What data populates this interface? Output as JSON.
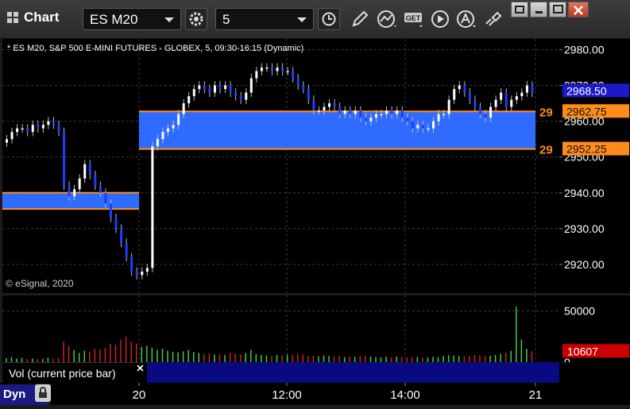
{
  "toolbar": {
    "title": "Chart",
    "symbol": "ES M20",
    "interval": "5",
    "get_label": "GET"
  },
  "chart": {
    "header": "* ES M20, S&P 500 E-MINI FUTURES - GLOBEX, 5, 09:30-16:15 (Dynamic)",
    "watermark": "© eSignal, 2020",
    "y_ticks": [
      "2980.00",
      "2970.00",
      "2960.00",
      "2950.00",
      "2940.00",
      "2930.00",
      "2920.00"
    ],
    "last_price": "2968.50",
    "zone_upper_price": "2962.75",
    "zone_lower_price": "2952.25",
    "zone_upper_short": "29",
    "zone_lower_short": "29"
  },
  "volume": {
    "label": "Vol (current price bar)",
    "y_ticks": [
      "50000",
      "0"
    ],
    "current": "10607"
  },
  "xaxis": {
    "ticks": [
      "20",
      "12:00",
      "14:00",
      "21"
    ]
  },
  "footer": {
    "mode": "Dyn"
  },
  "colors": {
    "zone_fill": "#2f6bff",
    "zone_line": "#ff8c1a",
    "up_candle": "#ffffff",
    "down_candle": "#1e3cff",
    "vol_up": "#44cc44",
    "vol_down": "#cc2222",
    "last_price_bg": "#1a1acc",
    "current_vol_bg": "#cc0000"
  },
  "chart_data": {
    "type": "candlestick",
    "series_price": [
      2955,
      2957,
      2958,
      2958,
      2957,
      2959,
      2958,
      2959,
      2960,
      2959,
      2957,
      2942,
      2939,
      2941,
      2944,
      2948,
      2945,
      2942,
      2940,
      2937,
      2933,
      2930,
      2926,
      2922,
      2918,
      2917,
      2918,
      2919,
      2953,
      2955,
      2957,
      2958,
      2959,
      2962,
      2965,
      2967,
      2969,
      2970,
      2969,
      2968,
      2970,
      2969,
      2970,
      2968,
      2967,
      2966,
      2968,
      2972,
      2974,
      2975,
      2975,
      2974,
      2975,
      2974,
      2974,
      2972,
      2970,
      2969,
      2966,
      2963,
      2963,
      2964,
      2965,
      2964,
      2962,
      2963,
      2962,
      2963,
      2961,
      2960,
      2961,
      2962,
      2962,
      2963,
      2962,
      2963,
      2961,
      2960,
      2958,
      2959,
      2958,
      2958,
      2960,
      2962,
      2962,
      2966,
      2969,
      2970,
      2968,
      2966,
      2964,
      2962,
      2961,
      2964,
      2966,
      2968,
      2964,
      2966,
      2967,
      2968,
      2970,
      2968
    ],
    "series_volume": [
      4000,
      5000,
      3500,
      4200,
      3000,
      3500,
      2800,
      3200,
      4500,
      3000,
      4000,
      20000,
      16000,
      12000,
      9000,
      11000,
      10000,
      13000,
      12000,
      14000,
      18000,
      17000,
      22000,
      25000,
      20000,
      18000,
      15000,
      16000,
      14000,
      12000,
      13000,
      11000,
      10000,
      9500,
      10500,
      12000,
      10000,
      9000,
      8000,
      8500,
      7500,
      8000,
      7000,
      9000,
      8000,
      7500,
      9000,
      12000,
      8000,
      7000,
      6500,
      6000,
      7000,
      6500,
      7200,
      6800,
      8000,
      7500,
      6000,
      6200,
      5800,
      6400,
      6000,
      5500,
      6200,
      5000,
      5400,
      5200,
      5800,
      6000,
      5500,
      5000,
      4800,
      5200,
      4900,
      5500,
      5000,
      4600,
      4800,
      5100,
      4700,
      4500,
      5200,
      4800,
      6000,
      7000,
      6500,
      6000,
      5500,
      6000,
      7000,
      6500,
      6000,
      6200,
      7000,
      8000,
      9000,
      11000,
      54000,
      22000,
      13000,
      10607
    ],
    "ylim": [
      2912,
      2983
    ],
    "zones": [
      {
        "from": 2940.0,
        "to": 2935.5,
        "session": "prior"
      },
      {
        "from": 2962.75,
        "to": 2952.25,
        "session": "current"
      }
    ]
  }
}
